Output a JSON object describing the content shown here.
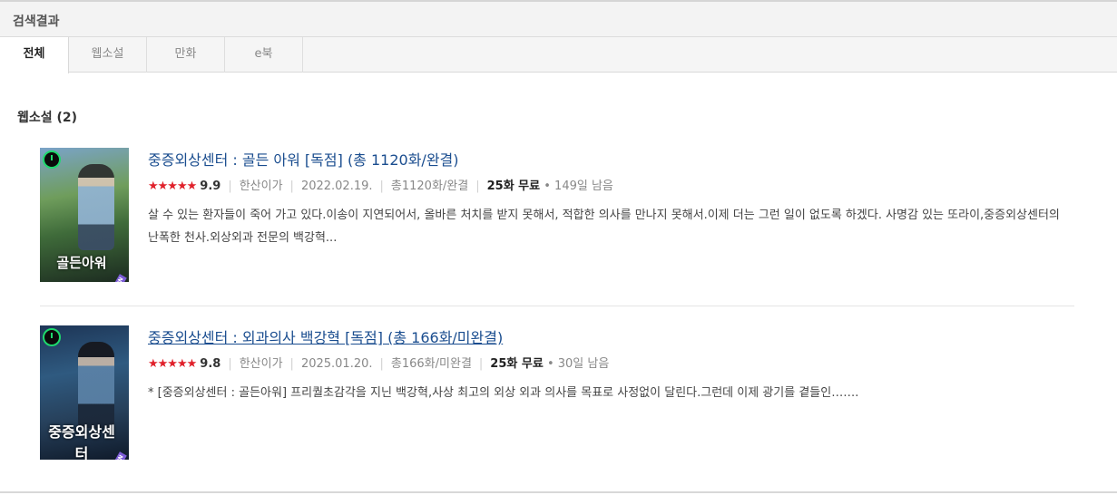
{
  "header": {
    "title": "검색결과"
  },
  "tabs": [
    {
      "label": "전체",
      "active": true
    },
    {
      "label": "웹소설",
      "active": false
    },
    {
      "label": "만화",
      "active": false
    },
    {
      "label": "e북",
      "active": false
    }
  ],
  "section": {
    "title": "웹소설 (2)"
  },
  "items": [
    {
      "title": "중증외상센터 : 골든 아워 [독점] (총 1120화/완결)",
      "cover_text": "골든아워",
      "cover_badge": "SERIES EDITION",
      "stars": "★★★★★",
      "rating": "9.9",
      "author": "한산이가",
      "date": "2022.02.19.",
      "episodes": "총1120화/완결",
      "free": "25화 무료",
      "remaining": "• 149일 남음",
      "desc": "살 수 있는 환자들이 죽어 가고 있다.이송이 지연되어서, 올바른 처치를 받지 못해서, 적합한 의사를 만나지 못해서.이제 더는 그런 일이 없도록 하겠다. 사명감 있는 또라이,중증외상센터의 난폭한 천사.외상외과 전문의 백강혁..."
    },
    {
      "title": "중증외상센터 : 외과의사 백강혁 [독점] (총 166화/미완결)",
      "cover_text": "중증외상센터",
      "cover_badge": "SERIES EDITION",
      "stars": "★★★★★",
      "rating": "9.8",
      "author": "한산이가",
      "date": "2025.01.20.",
      "episodes": "총166화/미완결",
      "free": "25화 무료",
      "remaining": "• 30일 남음",
      "desc": "* [중증외상센터 : 골든아워] 프리퀄초감각을 지닌 백강혁,사상 최고의 외상 외과 의사를 목표로 사정없이 달린다.그런데 이제 광기를 곁들인……."
    }
  ]
}
